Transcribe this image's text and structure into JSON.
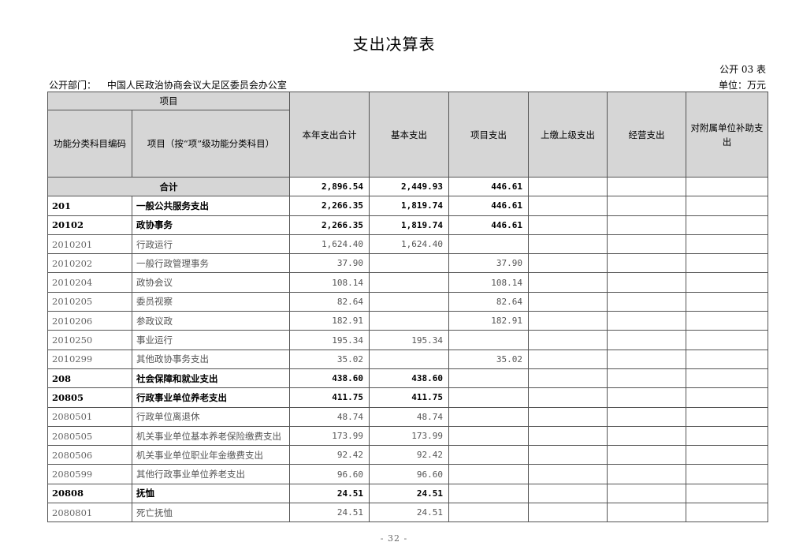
{
  "title": "支出决算表",
  "form_no": "公开 03 表",
  "dept_label": "公开部门：",
  "dept_name": "中国人民政治协商会议大足区委员会办公室",
  "unit": "单位：万元",
  "headers": {
    "item_group": "项目",
    "code": "功能分类科目编码",
    "name": "项目（按“项”级功能分类科目）",
    "total": "本年支出合计",
    "basic": "基本支出",
    "project": "项目支出",
    "upper": "上缴上级支出",
    "business": "经营支出",
    "subsidy": "对附属单位补助支出"
  },
  "total_row": {
    "label": "合计",
    "total": "2,896.54",
    "basic": "2,449.93",
    "project": "446.61",
    "upper": "",
    "business": "",
    "subsidy": ""
  },
  "rows": [
    {
      "code": "201",
      "name": "一般公共服务支出",
      "total": "2,266.35",
      "basic": "1,819.74",
      "project": "446.61",
      "upper": "",
      "business": "",
      "subsidy": "",
      "bold": true
    },
    {
      "code": "20102",
      "name": "政协事务",
      "total": "2,266.35",
      "basic": "1,819.74",
      "project": "446.61",
      "upper": "",
      "business": "",
      "subsidy": "",
      "bold": true
    },
    {
      "code": "2010201",
      "name": "行政运行",
      "total": "1,624.40",
      "basic": "1,624.40",
      "project": "",
      "upper": "",
      "business": "",
      "subsidy": "",
      "bold": false
    },
    {
      "code": "2010202",
      "name": "一般行政管理事务",
      "total": "37.90",
      "basic": "",
      "project": "37.90",
      "upper": "",
      "business": "",
      "subsidy": "",
      "bold": false
    },
    {
      "code": "2010204",
      "name": "政协会议",
      "total": "108.14",
      "basic": "",
      "project": "108.14",
      "upper": "",
      "business": "",
      "subsidy": "",
      "bold": false
    },
    {
      "code": "2010205",
      "name": "委员视察",
      "total": "82.64",
      "basic": "",
      "project": "82.64",
      "upper": "",
      "business": "",
      "subsidy": "",
      "bold": false
    },
    {
      "code": "2010206",
      "name": "参政议政",
      "total": "182.91",
      "basic": "",
      "project": "182.91",
      "upper": "",
      "business": "",
      "subsidy": "",
      "bold": false
    },
    {
      "code": "2010250",
      "name": "事业运行",
      "total": "195.34",
      "basic": "195.34",
      "project": "",
      "upper": "",
      "business": "",
      "subsidy": "",
      "bold": false
    },
    {
      "code": "2010299",
      "name": "其他政协事务支出",
      "total": "35.02",
      "basic": "",
      "project": "35.02",
      "upper": "",
      "business": "",
      "subsidy": "",
      "bold": false
    },
    {
      "code": "208",
      "name": "社会保障和就业支出",
      "total": "438.60",
      "basic": "438.60",
      "project": "",
      "upper": "",
      "business": "",
      "subsidy": "",
      "bold": true
    },
    {
      "code": "20805",
      "name": "行政事业单位养老支出",
      "total": "411.75",
      "basic": "411.75",
      "project": "",
      "upper": "",
      "business": "",
      "subsidy": "",
      "bold": true
    },
    {
      "code": "2080501",
      "name": "行政单位离退休",
      "total": "48.74",
      "basic": "48.74",
      "project": "",
      "upper": "",
      "business": "",
      "subsidy": "",
      "bold": false
    },
    {
      "code": "2080505",
      "name": "机关事业单位基本养老保险缴费支出",
      "total": "173.99",
      "basic": "173.99",
      "project": "",
      "upper": "",
      "business": "",
      "subsidy": "",
      "bold": false
    },
    {
      "code": "2080506",
      "name": "机关事业单位职业年金缴费支出",
      "total": "92.42",
      "basic": "92.42",
      "project": "",
      "upper": "",
      "business": "",
      "subsidy": "",
      "bold": false
    },
    {
      "code": "2080599",
      "name": "其他行政事业单位养老支出",
      "total": "96.60",
      "basic": "96.60",
      "project": "",
      "upper": "",
      "business": "",
      "subsidy": "",
      "bold": false
    },
    {
      "code": "20808",
      "name": "抚恤",
      "total": "24.51",
      "basic": "24.51",
      "project": "",
      "upper": "",
      "business": "",
      "subsidy": "",
      "bold": true
    },
    {
      "code": "2080801",
      "name": "死亡抚恤",
      "total": "24.51",
      "basic": "24.51",
      "project": "",
      "upper": "",
      "business": "",
      "subsidy": "",
      "bold": false
    }
  ],
  "page_number": "- 32 -"
}
